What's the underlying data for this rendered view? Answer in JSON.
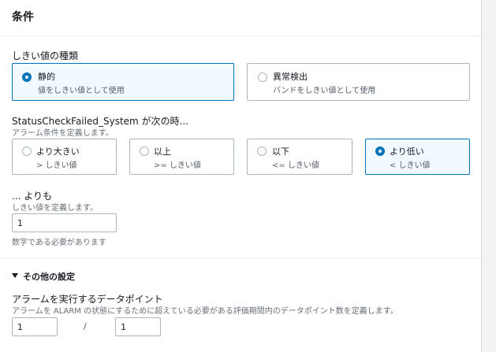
{
  "section": {
    "title": "条件"
  },
  "threshold_type": {
    "label": "しきい値の種類",
    "options": [
      {
        "title": "静的",
        "desc": "値をしきい値として使用",
        "selected": true
      },
      {
        "title": "異常検出",
        "desc": "バンドをしきい値として使用",
        "selected": false
      }
    ]
  },
  "comparison": {
    "label": "StatusCheckFailed_System が次の時...",
    "desc": "アラーム条件を定義します。",
    "options": [
      {
        "title": "より大きい",
        "desc": "> しきい値",
        "selected": false
      },
      {
        "title": "以上",
        "desc": ">= しきい値",
        "selected": false
      },
      {
        "title": "以下",
        "desc": "<= しきい値",
        "selected": false
      },
      {
        "title": "より低い",
        "desc": "< しきい値",
        "selected": true
      }
    ]
  },
  "threshold": {
    "label": "... よりも",
    "desc": "しきい値を定義します。",
    "value": "1",
    "hint": "数字である必要があります"
  },
  "additional": {
    "title": "その他の設定",
    "datapoints": {
      "label": "アラームを実行するデータポイント",
      "desc": "アラームを ALARM の状態にするために超えている必要がある評価期間内のデータポイント数を定義します。",
      "value_a": "1",
      "separator": "/",
      "value_b": "1"
    }
  }
}
